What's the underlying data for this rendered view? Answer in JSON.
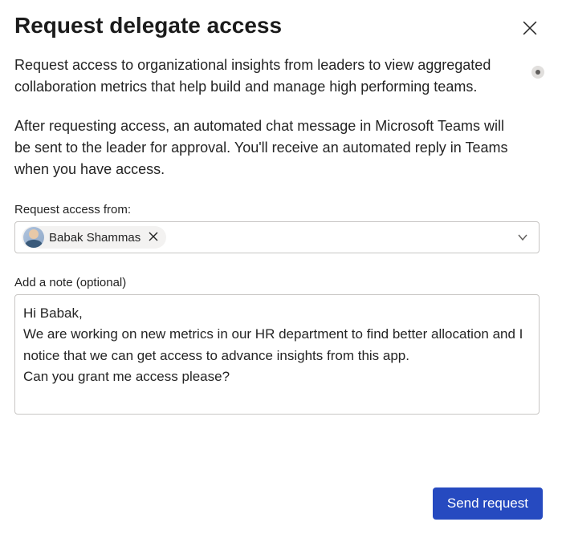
{
  "dialog": {
    "title": "Request delegate access",
    "description_p1": "Request access to organizational insights from leaders to view aggregated collaboration metrics that help build and manage high performing teams.",
    "description_p2": "After requesting access, an automated chat message in Microsoft Teams will be sent to the leader for approval. You'll receive an automated reply in Teams when you have access."
  },
  "picker": {
    "label": "Request access from:",
    "selected": {
      "name": "Babak Shammas"
    }
  },
  "note": {
    "label": "Add a note (optional)",
    "value": "Hi Babak,\nWe are working on new metrics in our HR department to find better allocation and I notice that we can get access to advance insights from this app.\nCan you grant me access please?"
  },
  "actions": {
    "send": "Send request"
  }
}
